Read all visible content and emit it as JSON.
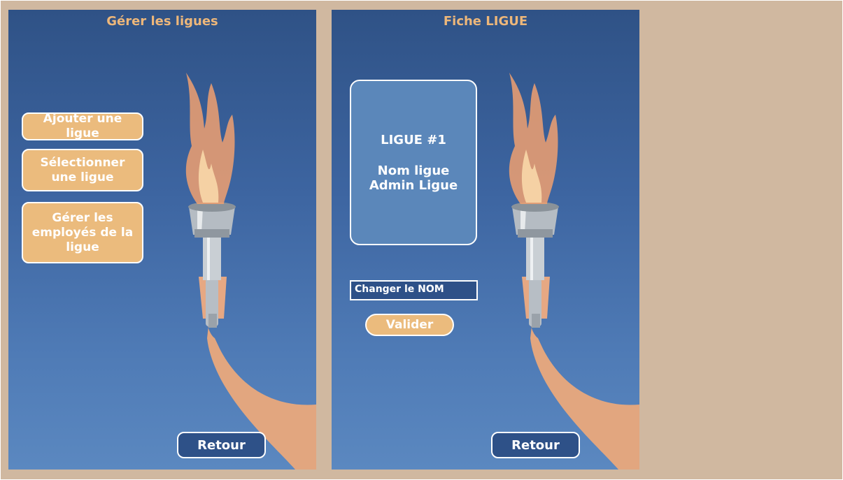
{
  "left_screen": {
    "title": "Gérer les ligues",
    "buttons": {
      "add": "Ajouter une ligue",
      "select": "Sélectionner une ligue",
      "manage": "Gérer les employés de la ligue"
    },
    "back": "Retour"
  },
  "right_screen": {
    "title": "Fiche LIGUE",
    "card": {
      "number": "LIGUE #1",
      "name": "Nom ligue",
      "admin": "Admin Ligue"
    },
    "name_input_value": "Changer le NOM",
    "validate": "Valider",
    "back": "Retour"
  },
  "colors": {
    "background": "#d0b8a0",
    "screen_blue": "#3d65a1",
    "accent_orange": "#ebbb7d",
    "navy": "#2e5188",
    "card_blue": "#5b87ba"
  }
}
